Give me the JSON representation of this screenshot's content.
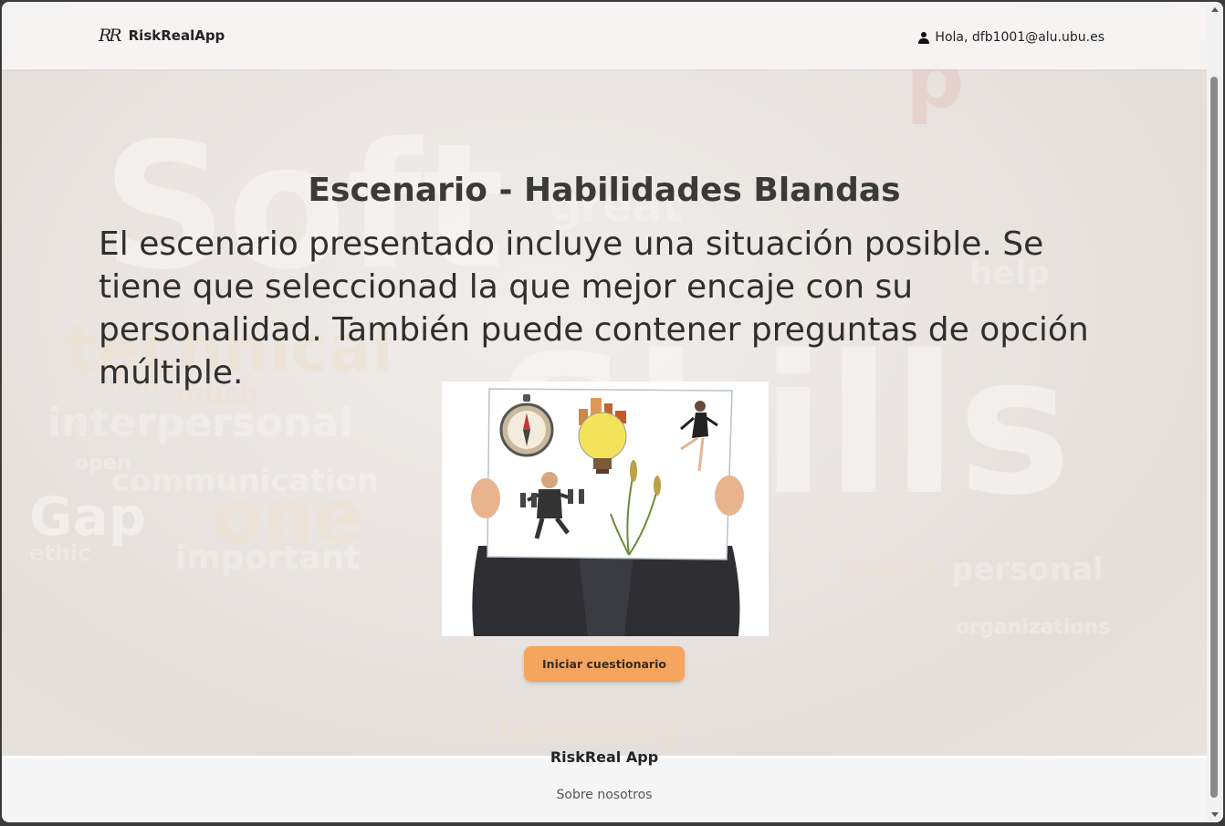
{
  "navbar": {
    "brand_logo": "RR",
    "brand_name": "RiskRealApp",
    "user_greeting": "Hola, dfb1001@alu.ubu.es"
  },
  "main": {
    "title": "Escenario - Habilidades Blandas",
    "description": "El escenario presentado incluye una situación posible. Se tiene que seleccionad la que mejor encaje con su personalidad. También puede contener preguntas de opción múltiple.",
    "start_button_label": "Iniciar cuestionario"
  },
  "footer": {
    "title": "RiskReal App",
    "about_link": "Sobre nosotros"
  },
  "colors": {
    "button": "#f5a55d",
    "navbar": "#f6f4f3",
    "footer": "#f5f5f5"
  }
}
